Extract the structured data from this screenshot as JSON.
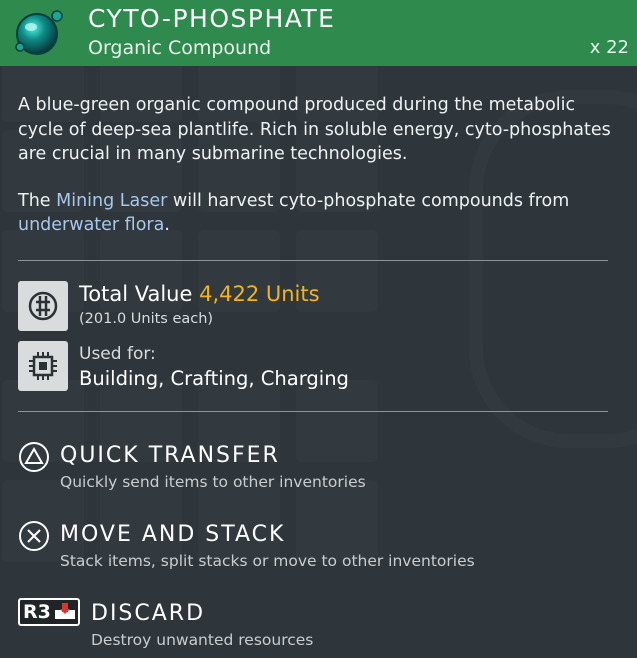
{
  "header": {
    "title": "CYTO-PHOSPHATE",
    "subtitle": "Organic Compound",
    "quantity": "x 22",
    "bg_color": "#2f8a4e",
    "icon": "cyto-phosphate-orb-icon"
  },
  "description": {
    "paragraph1": "A blue-green organic compound produced during the metabolic cycle of deep-sea plantlife. Rich in soluble energy, cyto-phosphates are crucial in many submarine technologies.",
    "p2_prefix": "The ",
    "p2_link1": "Mining Laser",
    "p2_middle": " will harvest cyto-phosphate compounds from ",
    "p2_link2": "underwater flora",
    "p2_suffix": "."
  },
  "value": {
    "label": "Total Value",
    "amount": "4,422 Units",
    "each": "(201.0 Units each)",
    "icon": "units-currency-icon",
    "amount_color": "#f2b31e"
  },
  "usage": {
    "label": "Used for:",
    "uses": "Building, Crafting, Charging",
    "icon": "chip-icon"
  },
  "actions": [
    {
      "title": "QUICK TRANSFER",
      "desc": "Quickly send items to other inventories",
      "icon": "triangle-button-icon"
    },
    {
      "title": "MOVE AND STACK",
      "desc": "Stack items, split stacks or move to other inventories",
      "icon": "cross-button-icon"
    },
    {
      "title": "DISCARD",
      "desc": "Destroy unwanted resources",
      "icon": "r3-button-icon",
      "button_label": "R3"
    }
  ]
}
